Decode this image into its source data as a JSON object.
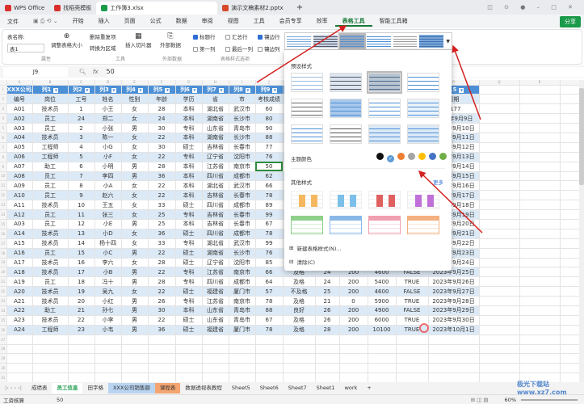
{
  "window_tabs": [
    {
      "label": "WPS Office",
      "color": "#d9302c"
    },
    {
      "label": "找稻壳模板",
      "color": "#d9302c"
    },
    {
      "label": "工作簿3.xlsx",
      "color": "#1a9a4a"
    },
    {
      "label": "演示文稿素材2.pptx",
      "color": "#d9482c"
    }
  ],
  "menu": {
    "file": "文件",
    "items": [
      "开始",
      "插入",
      "页面",
      "公式",
      "数据",
      "审阅",
      "视图",
      "工具",
      "会员专享",
      "效率",
      "表格工具",
      "智能工具箱"
    ],
    "active": "表格工具",
    "share": "分享"
  },
  "ribbon": {
    "table_name_label": "表名称:",
    "table_name_value": "表1",
    "resize": "调整表格大小",
    "group_props": "属性",
    "remove_dup": "删除重复项",
    "to_range": "转换为区域",
    "slicer": "插入切片器",
    "group_tools": "工具",
    "external": "外部数据",
    "group_ext": "外部数据",
    "opts": [
      {
        "label": "标题行",
        "on": true
      },
      {
        "label": "汇总行",
        "on": false
      },
      {
        "label": "镶边行",
        "on": true
      },
      {
        "label": "第一列",
        "on": false
      },
      {
        "label": "最后一列",
        "on": false
      },
      {
        "label": "镶边列",
        "on": false
      }
    ],
    "group_opts": "表格样式选项"
  },
  "formula": {
    "cell": "J9",
    "fx": "fx",
    "value": "50"
  },
  "columns": [
    "A",
    "B",
    "C",
    "D",
    "E",
    "F",
    "G",
    "H",
    "I",
    "J",
    "K",
    "L",
    "M",
    "N",
    "O",
    "P",
    "Q",
    "R",
    "S",
    "T"
  ],
  "header_row": [
    "XXX公司员",
    "列1",
    "列2",
    "列3",
    "列4",
    "列5",
    "列6",
    "列7",
    "列8",
    "列9",
    "",
    "",
    "",
    "",
    "",
    "列15"
  ],
  "title_row": [
    "编号",
    "岗位",
    "工号",
    "姓名",
    "性别",
    "年龄",
    "学历",
    "省",
    "市",
    "考核成绩",
    "",
    "",
    "",
    "",
    "",
    "日期"
  ],
  "rows": [
    [
      "A01",
      "技术员",
      "1",
      "小王",
      "女",
      "28",
      "本科",
      "湖北省",
      "武汉市",
      "60",
      "",
      "",
      "",
      "",
      "",
      "5177"
    ],
    [
      "A02",
      "员工",
      "24",
      "郑二",
      "女",
      "24",
      "本科",
      "湖南省",
      "长沙市",
      "80",
      "",
      "",
      "",
      "",
      "",
      "2023年9月9日"
    ],
    [
      "A03",
      "员工",
      "2",
      "小张",
      "男",
      "30",
      "专科",
      "山东省",
      "青岛市",
      "90",
      "",
      "",
      "",
      "",
      "",
      "2023年9月10日"
    ],
    [
      "A04",
      "技术员",
      "3",
      "陈一",
      "女",
      "22",
      "本科",
      "湖南省",
      "长沙市",
      "88",
      "",
      "",
      "",
      "",
      "",
      "2023年9月11日"
    ],
    [
      "A05",
      "工程师",
      "4",
      "小G",
      "女",
      "30",
      "硕士",
      "吉林省",
      "长春市",
      "77",
      "",
      "",
      "",
      "",
      "",
      "2023年9月12日"
    ],
    [
      "A06",
      "工程师",
      "5",
      "小F",
      "女",
      "22",
      "专科",
      "辽宁省",
      "沈阳市",
      "76",
      "",
      "",
      "",
      "",
      "",
      "2023年9月13日"
    ],
    [
      "A07",
      "助工",
      "6",
      "小明",
      "男",
      "28",
      "本科",
      "江苏省",
      "南京市",
      "50",
      "",
      "",
      "",
      "",
      "",
      "2023年9月14日"
    ],
    [
      "A08",
      "员工",
      "7",
      "李四",
      "男",
      "36",
      "本科",
      "四川省",
      "成都市",
      "62",
      "",
      "",
      "",
      "",
      "",
      "2023年9月15日"
    ],
    [
      "A09",
      "员工",
      "8",
      "小A",
      "女",
      "22",
      "本科",
      "湖北省",
      "武汉市",
      "66",
      "",
      "",
      "",
      "",
      "",
      "2023年9月16日"
    ],
    [
      "A10",
      "员工",
      "9",
      "赵六",
      "女",
      "22",
      "本科",
      "吉林省",
      "长春市",
      "78",
      "",
      "",
      "",
      "",
      "",
      "2023年9月17日"
    ],
    [
      "A11",
      "技术员",
      "10",
      "王五",
      "女",
      "33",
      "硕士",
      "四川省",
      "成都市",
      "89",
      "",
      "",
      "",
      "",
      "",
      "2023年9月18日"
    ],
    [
      "A12",
      "员工",
      "11",
      "张三",
      "女",
      "25",
      "专科",
      "吉林省",
      "长春市",
      "99",
      "",
      "",
      "",
      "",
      "",
      "2023年9月19日"
    ],
    [
      "A03",
      "员工",
      "12",
      "小E",
      "男",
      "25",
      "本科",
      "吉林省",
      "长春市",
      "67",
      "",
      "",
      "",
      "",
      "",
      "2023年9月20日"
    ],
    [
      "A14",
      "技术员",
      "13",
      "小D",
      "女",
      "36",
      "硕士",
      "四川省",
      "成都市",
      "78",
      "",
      "",
      "",
      "",
      "",
      "2023年9月21日"
    ],
    [
      "A15",
      "技术员",
      "14",
      "杨十四",
      "女",
      "33",
      "专科",
      "湖北省",
      "武汉市",
      "99",
      "",
      "",
      "",
      "",
      "",
      "2023年9月22日"
    ],
    [
      "A16",
      "员工",
      "15",
      "小C",
      "男",
      "22",
      "硕士",
      "湖南省",
      "长沙市",
      "76",
      "",
      "",
      "",
      "",
      "",
      "2023年9月23日"
    ],
    [
      "A17",
      "技术员",
      "16",
      "李六",
      "女",
      "28",
      "硕士",
      "辽宁省",
      "沈阳市",
      "85",
      "",
      "",
      "",
      "",
      "",
      "2023年9月24日"
    ],
    [
      "A18",
      "技术员",
      "17",
      "小B",
      "男",
      "22",
      "专科",
      "江苏省",
      "南京市",
      "66",
      "及格",
      "24",
      "200",
      "4600",
      "FALSE",
      "2023年9月25日"
    ],
    [
      "A19",
      "员工",
      "18",
      "冯十",
      "男",
      "28",
      "专科",
      "四川省",
      "成都市",
      "64",
      "及格",
      "24",
      "200",
      "5400",
      "TRUE",
      "2023年9月26日"
    ],
    [
      "A20",
      "技术员",
      "19",
      "吴九",
      "女",
      "22",
      "硕士",
      "福建省",
      "厦门市",
      "57",
      "不及格",
      "25",
      "200",
      "4600",
      "FALSE",
      "2023年9月27日"
    ],
    [
      "A21",
      "技术员",
      "20",
      "小红",
      "男",
      "26",
      "专科",
      "江苏省",
      "南京市",
      "78",
      "及格",
      "21",
      "0",
      "5900",
      "TRUE",
      "2023年9月28日"
    ],
    [
      "A22",
      "助工",
      "21",
      "孙七",
      "男",
      "30",
      "本科",
      "山东省",
      "青岛市",
      "88",
      "良好",
      "26",
      "200",
      "4900",
      "FALSE",
      "2023年9月29日"
    ],
    [
      "A23",
      "技术员",
      "22",
      "小李",
      "男",
      "22",
      "硕士",
      "山东省",
      "青岛市",
      "67",
      "及格",
      "26",
      "200",
      "6000",
      "TRUE",
      "2023年9月30日"
    ],
    [
      "A24",
      "工程师",
      "23",
      "小韦",
      "男",
      "36",
      "硕士",
      "福建省",
      "厦门市",
      "78",
      "及格",
      "28",
      "200",
      "10100",
      "TRUE",
      "2023年10月1日"
    ]
  ],
  "popup": {
    "preset": "预设样式",
    "theme": "主题颜色",
    "other": "其他样式",
    "more": "更多",
    "new_style": "新建表格样式(N)...",
    "clear": "清除(C)",
    "theme_colors": [
      "#111111",
      "#5b9bd5",
      "#ed7d31",
      "#a5a5a5",
      "#ffc000",
      "#4472c4",
      "#70ad47"
    ],
    "other_colors": [
      "#f5b860",
      "#7cc0ea",
      "#e06060",
      "#c070d8",
      "#8ed08a",
      "#8ab8e6",
      "#f0a0b0",
      "#f4b080"
    ]
  },
  "sheet_tabs": [
    {
      "label": "成绩表",
      "bg": ""
    },
    {
      "label": "员工信息",
      "bg": "#fff",
      "active": true
    },
    {
      "label": "田字格",
      "bg": ""
    },
    {
      "label": "XXX公司销售额",
      "bg": "#b8d4f0"
    },
    {
      "label": "课程表",
      "bg": "#f4a470"
    },
    {
      "label": "数据透视表教程",
      "bg": ""
    },
    {
      "label": "Sheet5",
      "bg": ""
    },
    {
      "label": "Sheet6",
      "bg": ""
    },
    {
      "label": "Sheet7",
      "bg": ""
    },
    {
      "label": "Sheet1",
      "bg": ""
    },
    {
      "label": "work",
      "bg": ""
    }
  ],
  "status": {
    "mode": "工资核算",
    "value": "50",
    "zoom": "60%"
  },
  "watermark": "极光下载站 www.xz7.com"
}
